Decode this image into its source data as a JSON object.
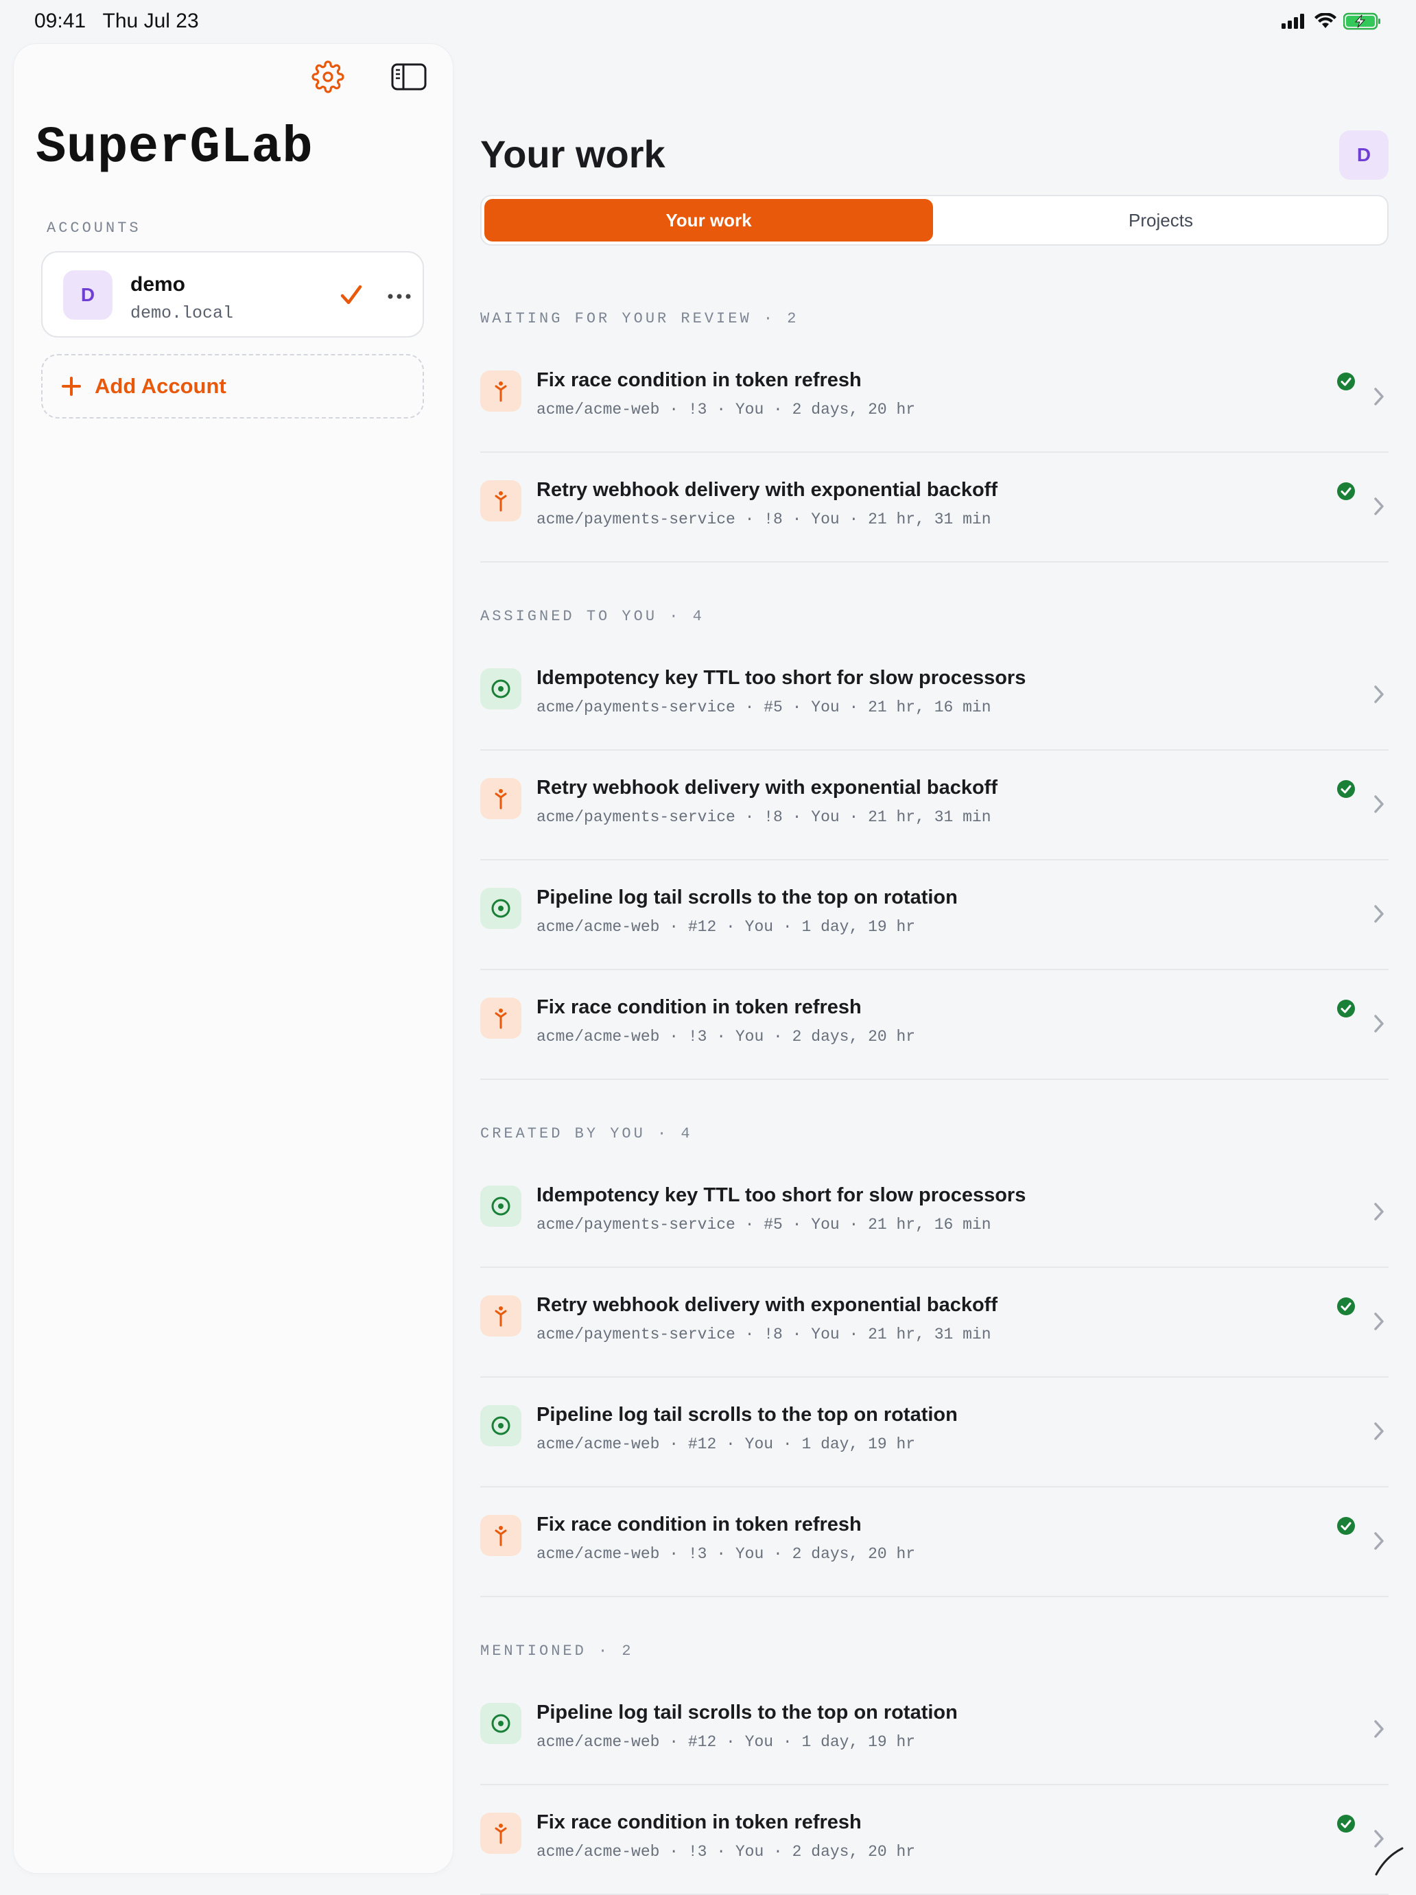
{
  "status_bar": {
    "time": "09:41",
    "date": "Thu Jul 23"
  },
  "sidebar": {
    "app_title": "SuperGLab",
    "accounts_caption": "ACCOUNTS",
    "account": {
      "avatar_letter": "D",
      "name": "demo",
      "host": "demo.local"
    },
    "add_account_label": "Add Account",
    "icons": {
      "settings": "gear-icon",
      "toggle": "sidebar-toggle-icon",
      "more": "ellipsis-icon",
      "check": "checkmark-icon",
      "add": "plus-icon"
    }
  },
  "main": {
    "title": "Your work",
    "avatar_letter": "D",
    "segments": [
      "Your work",
      "Projects"
    ],
    "selected_segment": "Your work",
    "sections": [
      {
        "header": "WAITING FOR YOUR REVIEW · 2",
        "items": [
          {
            "kind": "merge_request",
            "title": "Fix race condition in token refresh",
            "meta": "acme/acme-web · !3 · You · 2 days, 20 hr",
            "status": "passed"
          },
          {
            "kind": "merge_request",
            "title": "Retry webhook delivery with exponential backoff",
            "meta": "acme/payments-service · !8 · You · 21 hr, 31 min",
            "status": "passed"
          }
        ]
      },
      {
        "header": "ASSIGNED TO YOU · 4",
        "items": [
          {
            "kind": "issue",
            "title": "Idempotency key TTL too short for slow processors",
            "meta": "acme/payments-service · #5 · You · 21 hr, 16 min",
            "status": ""
          },
          {
            "kind": "merge_request",
            "title": "Retry webhook delivery with exponential backoff",
            "meta": "acme/payments-service · !8 · You · 21 hr, 31 min",
            "status": "passed"
          },
          {
            "kind": "issue",
            "title": "Pipeline log tail scrolls to the top on rotation",
            "meta": "acme/acme-web · #12 · You · 1 day, 19 hr",
            "status": ""
          },
          {
            "kind": "merge_request",
            "title": "Fix race condition in token refresh",
            "meta": "acme/acme-web · !3 · You · 2 days, 20 hr",
            "status": "passed"
          }
        ]
      },
      {
        "header": "CREATED BY YOU · 4",
        "items": [
          {
            "kind": "issue",
            "title": "Idempotency key TTL too short for slow processors",
            "meta": "acme/payments-service · #5 · You · 21 hr, 16 min",
            "status": ""
          },
          {
            "kind": "merge_request",
            "title": "Retry webhook delivery with exponential backoff",
            "meta": "acme/payments-service · !8 · You · 21 hr, 31 min",
            "status": "passed"
          },
          {
            "kind": "issue",
            "title": "Pipeline log tail scrolls to the top on rotation",
            "meta": "acme/acme-web · #12 · You · 1 day, 19 hr",
            "status": ""
          },
          {
            "kind": "merge_request",
            "title": "Fix race condition in token refresh",
            "meta": "acme/acme-web · !3 · You · 2 days, 20 hr",
            "status": "passed"
          }
        ]
      },
      {
        "header": "MENTIONED · 2",
        "items": [
          {
            "kind": "issue",
            "title": "Pipeline log tail scrolls to the top on rotation",
            "meta": "acme/acme-web · #12 · You · 1 day, 19 hr",
            "status": ""
          },
          {
            "kind": "merge_request",
            "title": "Fix race condition in token refresh",
            "meta": "acme/acme-web · !3 · You · 2 days, 20 hr",
            "status": "passed"
          }
        ]
      }
    ]
  },
  "colors": {
    "accent": "#e8590c",
    "issue_green": "#1a7f37",
    "avatar_bg": "#ede4fb",
    "avatar_fg": "#6f3fd3"
  }
}
